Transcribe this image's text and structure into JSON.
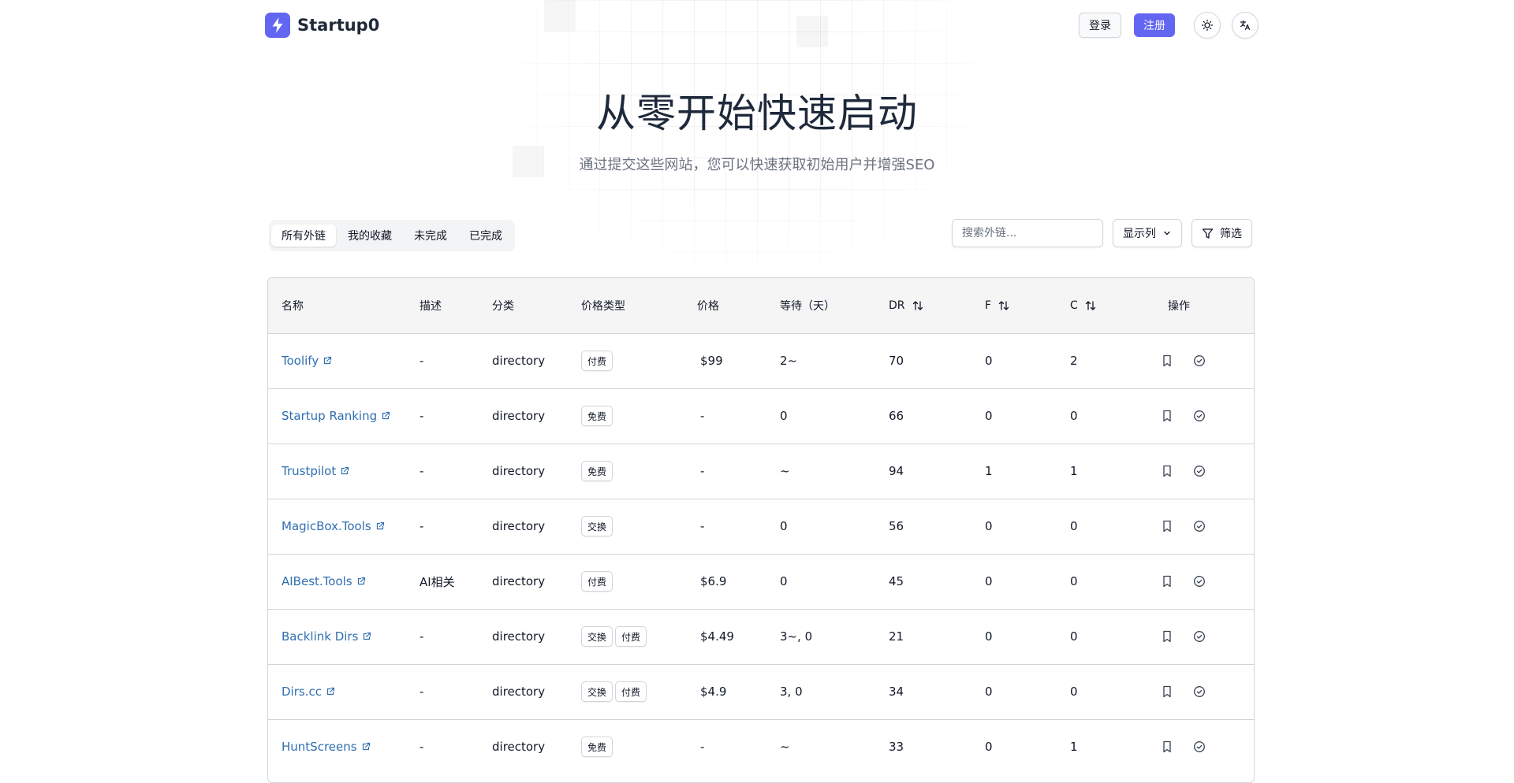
{
  "brand": {
    "name": "Startup0",
    "accent": "#6366f1"
  },
  "header": {
    "login_label": "登录",
    "register_label": "注册"
  },
  "hero": {
    "title": "从零开始快速启动",
    "subtitle": "通过提交这些网站，您可以快速获取初始用户并增强SEO"
  },
  "tabs": [
    {
      "label": "所有外链",
      "active": true
    },
    {
      "label": "我的收藏",
      "active": false
    },
    {
      "label": "未完成",
      "active": false
    },
    {
      "label": "已完成",
      "active": false
    }
  ],
  "toolbar": {
    "search_placeholder": "搜索外链...",
    "columns_label": "显示列",
    "filter_label": "筛选"
  },
  "table": {
    "headers": {
      "name": "名称",
      "desc": "描述",
      "category": "分类",
      "price_type": "价格类型",
      "price": "价格",
      "wait": "等待（天）",
      "dr": "DR",
      "f": "F",
      "c": "C",
      "ops": "操作"
    },
    "rows": [
      {
        "name": "Toolify",
        "desc": "-",
        "category": "directory",
        "price_types": [
          "付费"
        ],
        "price": "$99",
        "wait": "2~",
        "dr": "70",
        "f": "0",
        "c": "2"
      },
      {
        "name": "Startup Ranking",
        "desc": "-",
        "category": "directory",
        "price_types": [
          "免费"
        ],
        "price": "-",
        "wait": "0",
        "dr": "66",
        "f": "0",
        "c": "0"
      },
      {
        "name": "Trustpilot",
        "desc": "-",
        "category": "directory",
        "price_types": [
          "免费"
        ],
        "price": "-",
        "wait": "~",
        "dr": "94",
        "f": "1",
        "c": "1"
      },
      {
        "name": "MagicBox.Tools",
        "desc": "-",
        "category": "directory",
        "price_types": [
          "交换"
        ],
        "price": "-",
        "wait": "0",
        "dr": "56",
        "f": "0",
        "c": "0"
      },
      {
        "name": "AIBest.Tools",
        "desc": "AI相关",
        "category": "directory",
        "price_types": [
          "付费"
        ],
        "price": "$6.9",
        "wait": "0",
        "dr": "45",
        "f": "0",
        "c": "0"
      },
      {
        "name": "Backlink Dirs",
        "desc": "-",
        "category": "directory",
        "price_types": [
          "交换",
          "付费"
        ],
        "price": "$4.49",
        "wait": "3~, 0",
        "dr": "21",
        "f": "0",
        "c": "0"
      },
      {
        "name": "Dirs.cc",
        "desc": "-",
        "category": "directory",
        "price_types": [
          "交换",
          "付费"
        ],
        "price": "$4.9",
        "wait": "3, 0",
        "dr": "34",
        "f": "0",
        "c": "0"
      },
      {
        "name": "HuntScreens",
        "desc": "-",
        "category": "directory",
        "price_types": [
          "免费"
        ],
        "price": "-",
        "wait": "~",
        "dr": "33",
        "f": "0",
        "c": "1"
      }
    ]
  },
  "icons": {
    "logo": "lightning-icon",
    "theme": "sun-icon",
    "language": "translate-icon",
    "external": "external-link-icon",
    "bookmark": "bookmark-icon",
    "done": "check-circle-icon",
    "sort": "sort-icon",
    "chevron": "chevron-down-icon",
    "filter": "filter-icon"
  }
}
